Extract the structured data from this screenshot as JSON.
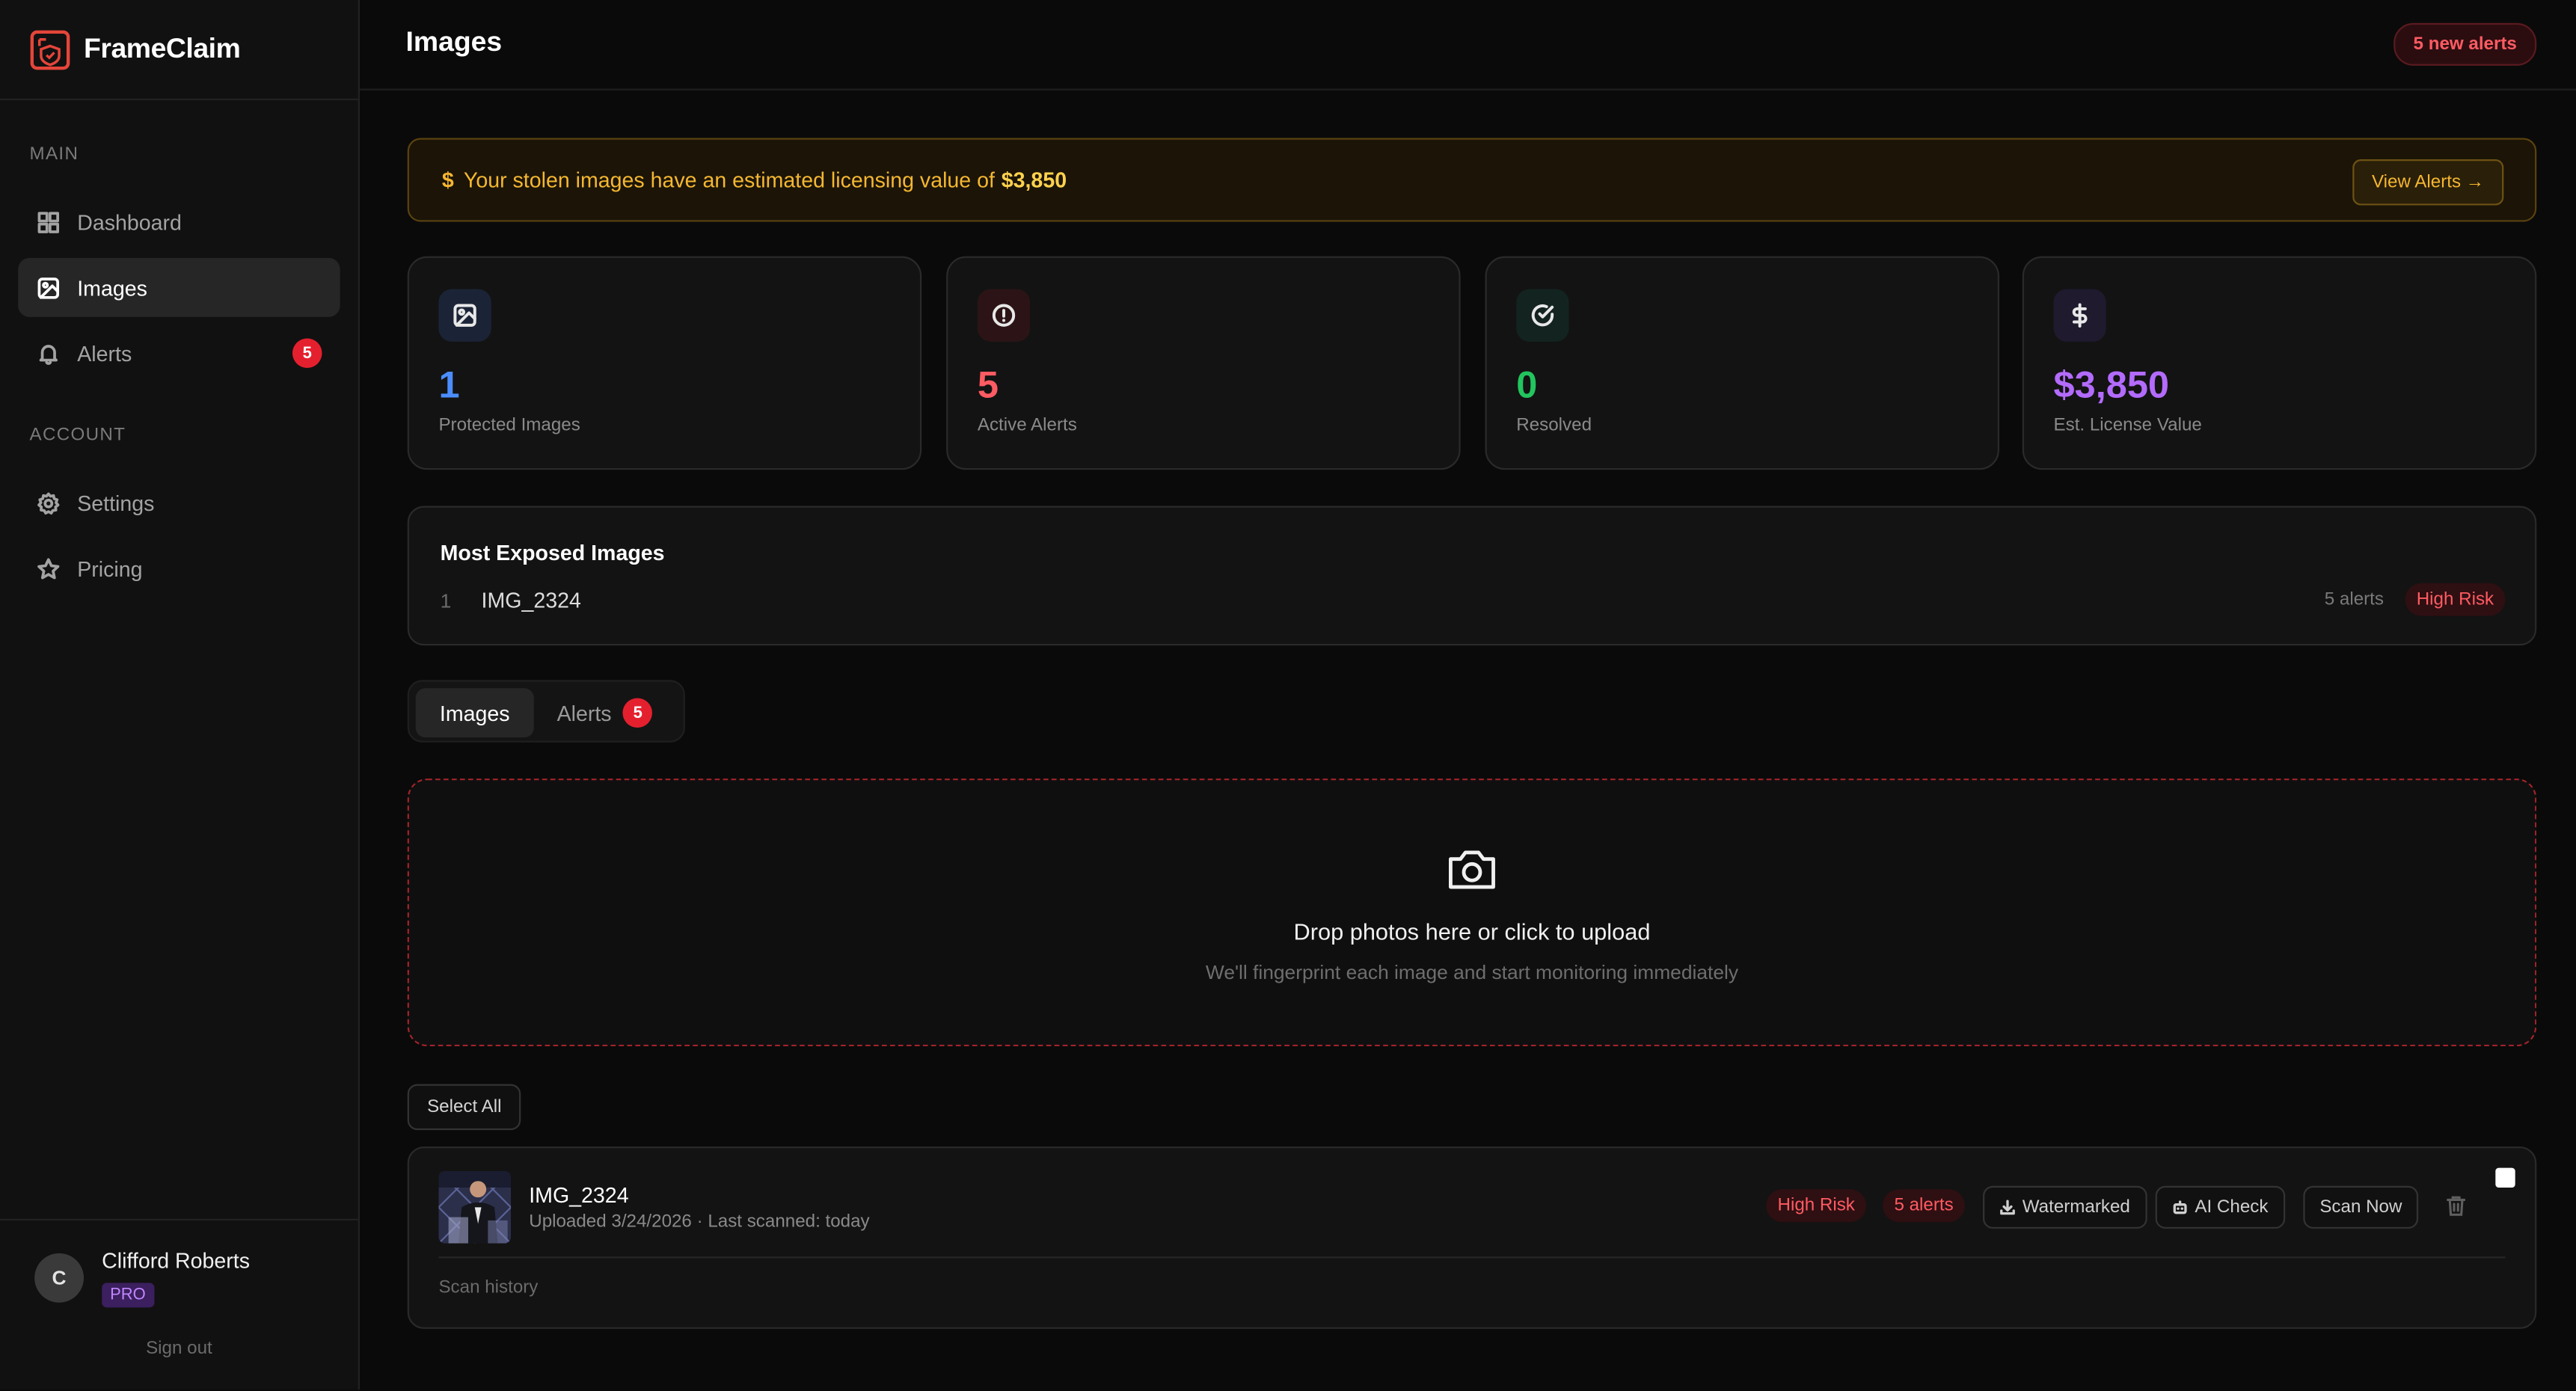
{
  "app": {
    "name": "FrameClaim"
  },
  "sidebar": {
    "sections": [
      {
        "label": "MAIN"
      },
      {
        "label": "ACCOUNT"
      }
    ],
    "items": [
      {
        "label": "Dashboard",
        "icon": "grid-icon"
      },
      {
        "label": "Images",
        "icon": "image-icon",
        "active": true
      },
      {
        "label": "Alerts",
        "icon": "bell-icon",
        "badge": "5"
      },
      {
        "label": "Settings",
        "icon": "gear-icon"
      },
      {
        "label": "Pricing",
        "icon": "star-icon"
      }
    ],
    "user": {
      "initial": "C",
      "name": "Clifford Roberts",
      "plan": "PRO",
      "signout": "Sign out"
    }
  },
  "header": {
    "title": "Images",
    "alerts_badge": "5 new alerts"
  },
  "banner": {
    "icon": "$",
    "text": "Your stolen images have an estimated licensing value of",
    "value": "$3,850",
    "button": "View Alerts →"
  },
  "stats": [
    {
      "value": "1",
      "label": "Protected Images",
      "icon": "image-icon",
      "color": "#4b8dff"
    },
    {
      "value": "5",
      "label": "Active Alerts",
      "icon": "alert-circle-icon",
      "color": "#ff5b62"
    },
    {
      "value": "0",
      "label": "Resolved",
      "icon": "check-circle-icon",
      "color": "#22c55e"
    },
    {
      "value": "$3,850",
      "label": "Est. License Value",
      "icon": "dollar-icon",
      "color": "#b36bff"
    }
  ],
  "most_exposed": {
    "title": "Most Exposed Images",
    "items": [
      {
        "index": "1",
        "name": "IMG_2324",
        "alerts": "5 alerts",
        "risk": "High Risk"
      }
    ]
  },
  "tabs": [
    {
      "label": "Images",
      "active": true
    },
    {
      "label": "Alerts",
      "badge": "5"
    }
  ],
  "dropzone": {
    "title": "Drop photos here or click to upload",
    "subtitle": "We'll fingerprint each image and start monitoring immediately"
  },
  "select_all": "Select All",
  "images": [
    {
      "name": "IMG_2324",
      "meta": "Uploaded 3/24/2026 · Last scanned: today",
      "risk": "High Risk",
      "alerts": "5 alerts",
      "actions": [
        "Watermarked",
        "AI Check",
        "Scan Now"
      ],
      "scan_history": "Scan history"
    }
  ]
}
